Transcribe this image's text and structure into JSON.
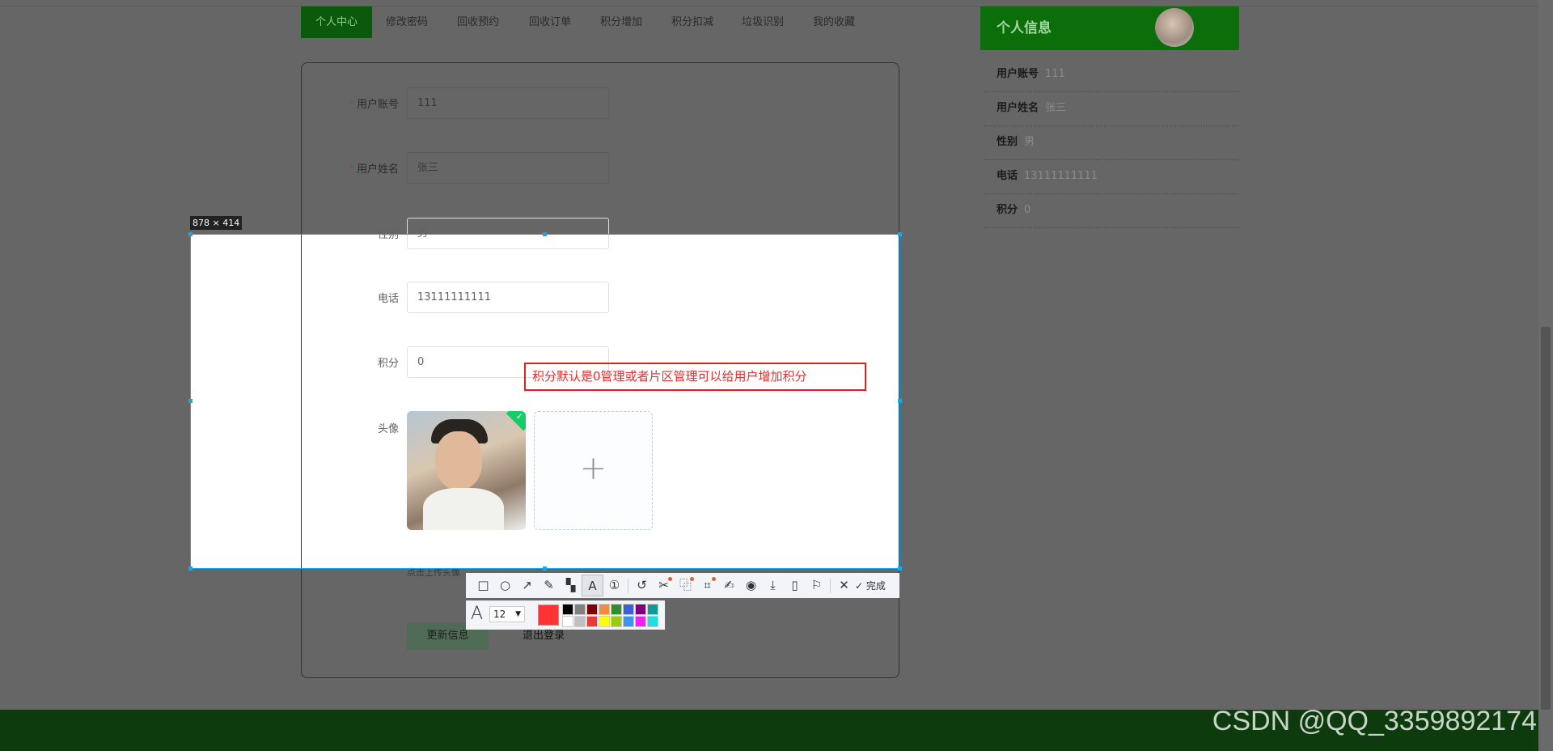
{
  "nav": {
    "tabs": [
      {
        "label": "个人中心",
        "active": true
      },
      {
        "label": "修改密码"
      },
      {
        "label": "回收预约"
      },
      {
        "label": "回收订单"
      },
      {
        "label": "积分增加"
      },
      {
        "label": "积分扣减"
      },
      {
        "label": "垃圾识别"
      },
      {
        "label": "我的收藏"
      }
    ]
  },
  "form": {
    "account": {
      "label": "用户账号",
      "value": "111",
      "required": "*"
    },
    "name": {
      "label": "用户姓名",
      "value": "张三",
      "required": "*"
    },
    "gender": {
      "label": "性别",
      "value": "男"
    },
    "phone": {
      "label": "电话",
      "value": "13111111111"
    },
    "points": {
      "label": "积分",
      "value": "0"
    },
    "avatar": {
      "label": "头像",
      "hint": "点击上传头像",
      "upload_icon": "+"
    },
    "update_button": "更新信息",
    "logout_button": "退出登录"
  },
  "profile": {
    "title": "个人信息",
    "rows": [
      {
        "label": "用户账号",
        "value": "111"
      },
      {
        "label": "用户姓名",
        "value": "张三"
      },
      {
        "label": "性别",
        "value": "男"
      },
      {
        "label": "电话",
        "value": "13111111111"
      },
      {
        "label": "积分",
        "value": "0"
      }
    ]
  },
  "screenshot_tool": {
    "size_label": "878 × 414",
    "annotation_text": "积分默认是0管理或者片区管理可以给用户增加积分",
    "tools": [
      "rectangle-icon",
      "ellipse-icon",
      "arrow-icon",
      "pencil-icon",
      "mosaic-icon",
      "text-icon",
      "number-icon",
      "undo-icon",
      "scissors-icon",
      "translate-icon",
      "ocr-icon",
      "pin-icon",
      "record-icon",
      "download-icon",
      "phone-icon",
      "bookmark-icon",
      "close-icon"
    ],
    "done_label": "完成",
    "font_size": "12",
    "current_color": "#ff3333",
    "palette": [
      "#000000",
      "#808080",
      "#800000",
      "#f08c3a",
      "#2f8f2f",
      "#3a5fd8",
      "#800080",
      "#119999",
      "#ffffff",
      "#c0c0c0",
      "#e83a3a",
      "#ffff00",
      "#9acd11",
      "#3a96e8",
      "#ee22ee",
      "#22dddd"
    ]
  },
  "watermark": "CSDN @QQ_3359892174"
}
